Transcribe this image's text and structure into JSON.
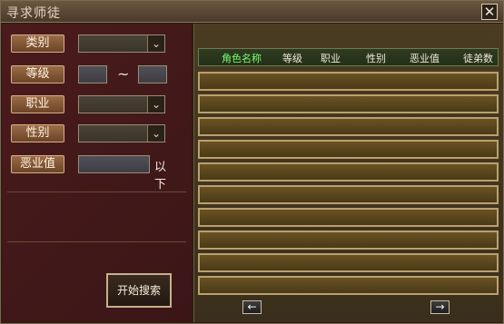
{
  "window": {
    "title": "寻求师徒",
    "close_glyph": "✕"
  },
  "filters": {
    "category": {
      "label": "类别",
      "value": ""
    },
    "level": {
      "label": "等级",
      "min": "",
      "max": "",
      "separator": "~"
    },
    "job": {
      "label": "职业",
      "value": ""
    },
    "gender": {
      "label": "性别",
      "value": ""
    },
    "evil": {
      "label": "恶业值",
      "value": "",
      "suffix": "以下"
    }
  },
  "actions": {
    "search_label": "开始搜索"
  },
  "table": {
    "columns": [
      "角色名称",
      "等级",
      "职业",
      "性别",
      "恶业值",
      "徒弟数"
    ],
    "rows": [
      {},
      {},
      {},
      {},
      {},
      {},
      {},
      {},
      {},
      {}
    ]
  },
  "pager": {
    "prev_glyph": "←",
    "next_glyph": "→"
  },
  "icons": {
    "dropdown": "chevron-down-icon",
    "close": "close-icon",
    "prev": "arrow-left-icon",
    "next": "arrow-right-icon"
  },
  "colors": {
    "left_panel": "#3b1617",
    "right_panel": "#3a2f1c",
    "header_active_text": "#76ff6c",
    "border_gold": "#bba06d"
  }
}
